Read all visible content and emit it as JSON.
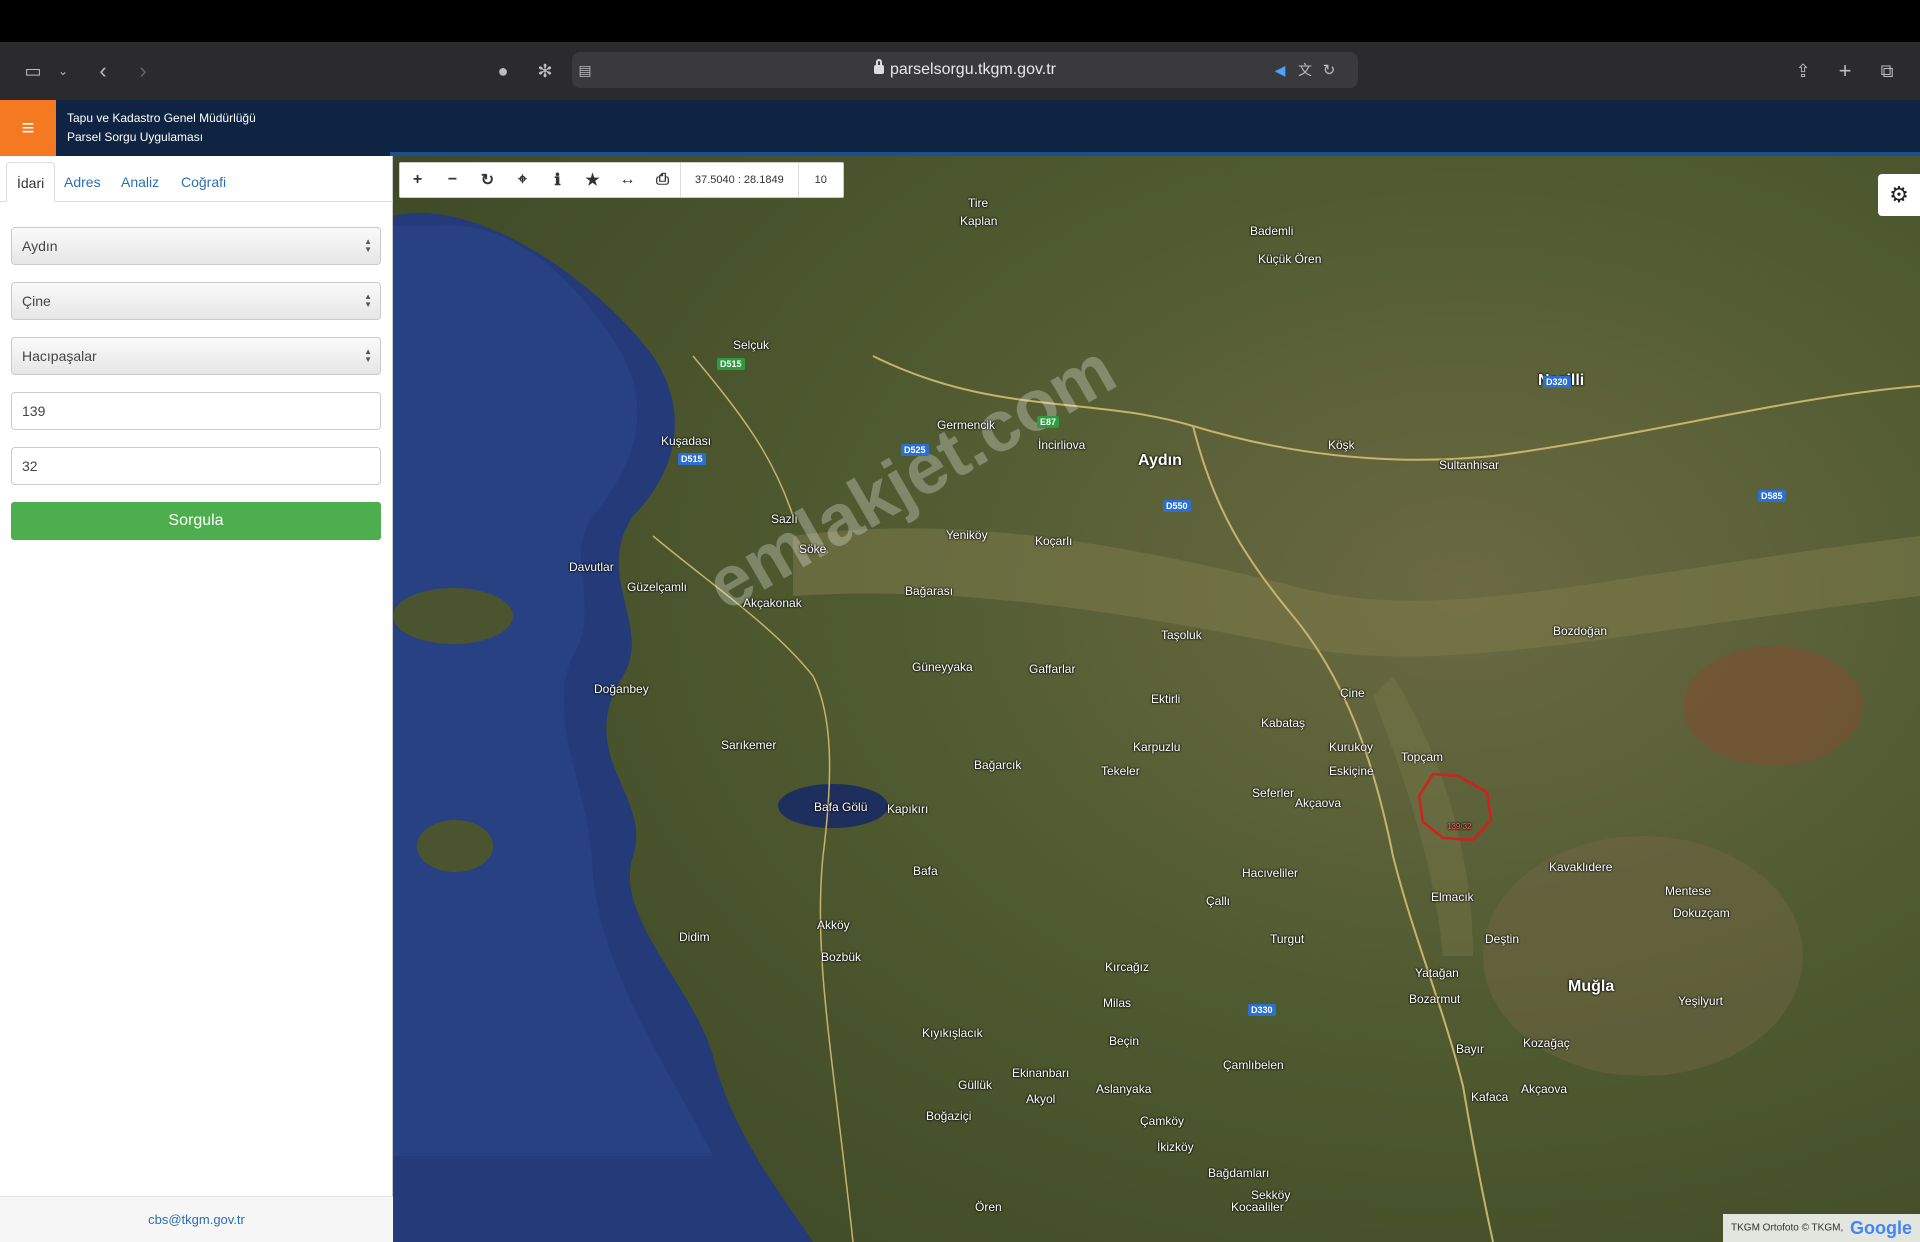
{
  "browser": {
    "url": "parselsorgu.tkgm.gov.tr"
  },
  "app": {
    "title_line1": "Tapu ve Kadastro Genel Müdürlüğü",
    "title_line2": "Parsel Sorgu Uygulaması"
  },
  "sidebar": {
    "tabs": [
      {
        "label": "İdari"
      },
      {
        "label": "Adres"
      },
      {
        "label": "Analiz"
      },
      {
        "label": "Coğrafi"
      }
    ],
    "il": "Aydın",
    "ilce": "Çine",
    "mahalle": "Hacıpaşalar",
    "ada": "139",
    "parsel": "32",
    "submit_label": "Sorgula",
    "footer_email": "cbs@tkgm.gov.tr"
  },
  "map": {
    "coordinates": "37.5040 : 28.1849",
    "zoom": "10",
    "parcel_label": "139/32",
    "watermark": "emlakjet.com",
    "attribution": "TKGM Ortofoto © TKGM,",
    "attribution_brand": "Google",
    "places": [
      {
        "name": "Aydın",
        "big": true
      },
      {
        "name": "Nazilli",
        "big": true
      },
      {
        "name": "Muğla",
        "big": true
      },
      {
        "name": "Kuşadası"
      },
      {
        "name": "Selçuk"
      },
      {
        "name": "Söke"
      },
      {
        "name": "Çine"
      },
      {
        "name": "Bafa Gölü"
      },
      {
        "name": "Didim"
      },
      {
        "name": "Yatağan"
      },
      {
        "name": "Koçarlı"
      },
      {
        "name": "Germencik"
      },
      {
        "name": "İncirliova"
      },
      {
        "name": "Köşk"
      },
      {
        "name": "Sultanhisar"
      },
      {
        "name": "Karpuzlu"
      },
      {
        "name": "Eskiçine"
      },
      {
        "name": "Akçaova"
      },
      {
        "name": "Milas"
      },
      {
        "name": "Bozdoğan"
      },
      {
        "name": "Kavaklıdere"
      },
      {
        "name": "Tire"
      },
      {
        "name": "Kaplan"
      },
      {
        "name": "Bademli"
      },
      {
        "name": "Küçük Ören"
      },
      {
        "name": "Topçam"
      },
      {
        "name": "Turgut"
      },
      {
        "name": "Kozağaç"
      },
      {
        "name": "Yeniköy"
      },
      {
        "name": "Bağarası"
      },
      {
        "name": "Ektirli"
      },
      {
        "name": "Kabataş"
      },
      {
        "name": "Kurukoy"
      },
      {
        "name": "Seferler"
      },
      {
        "name": "Elmacık"
      },
      {
        "name": "Deştin"
      },
      {
        "name": "Bozarmut"
      },
      {
        "name": "Bayır"
      },
      {
        "name": "Kafaca"
      },
      {
        "name": "Akçaova"
      },
      {
        "name": "Yeşilyurt"
      },
      {
        "name": "Mentese"
      },
      {
        "name": "Dokuzçam"
      },
      {
        "name": "Çamlıbelen"
      },
      {
        "name": "Ören"
      },
      {
        "name": "Güllük"
      },
      {
        "name": "Boğaziçi"
      },
      {
        "name": "Kıyıkışlacık"
      },
      {
        "name": "Bafa"
      },
      {
        "name": "Kapıkırı"
      },
      {
        "name": "Akköy"
      },
      {
        "name": "Bozbük"
      },
      {
        "name": "Davutlar"
      },
      {
        "name": "Güzelçamlı"
      },
      {
        "name": "Doğanbey"
      },
      {
        "name": "Sazlı"
      },
      {
        "name": "Sarıkemer"
      },
      {
        "name": "Akçakonak"
      },
      {
        "name": "Güneyyaka"
      },
      {
        "name": "Gaffarlar"
      },
      {
        "name": "Taşoluk"
      },
      {
        "name": "Bağarcık"
      },
      {
        "name": "Tekeler"
      },
      {
        "name": "Hacıveliler"
      },
      {
        "name": "Çallı"
      },
      {
        "name": "Kırcağız"
      },
      {
        "name": "Beçin"
      },
      {
        "name": "Ekinanbarı"
      },
      {
        "name": "Akyol"
      },
      {
        "name": "Aslanyaka"
      },
      {
        "name": "Çamköy"
      },
      {
        "name": "İkizköy"
      },
      {
        "name": "Bağdamları"
      },
      {
        "name": "Sekköy"
      },
      {
        "name": "Kocaaliler"
      }
    ],
    "roads": [
      {
        "name": "D550",
        "green": false
      },
      {
        "name": "D515",
        "green": false
      },
      {
        "name": "D525",
        "green": false
      },
      {
        "name": "D320",
        "green": false
      },
      {
        "name": "D330",
        "green": false
      },
      {
        "name": "D585",
        "green": false
      },
      {
        "name": "E87",
        "green": true
      },
      {
        "name": "D515",
        "green": true
      }
    ]
  }
}
